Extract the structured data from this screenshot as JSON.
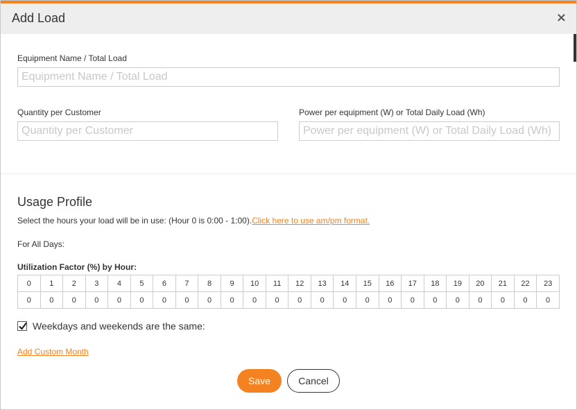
{
  "modal": {
    "title": "Add Load",
    "close_label": "×"
  },
  "fields": {
    "equipment_name": {
      "label": "Equipment Name / Total Load",
      "placeholder": "Equipment Name / Total Load",
      "value": ""
    },
    "quantity": {
      "label": "Quantity per Customer",
      "placeholder": "Quantity per Customer",
      "value": ""
    },
    "power": {
      "label": "Power per equipment (W) or Total Daily Load (Wh)",
      "placeholder": "Power per equipment (W) or Total Daily Load (Wh)",
      "value": ""
    }
  },
  "usage": {
    "title": "Usage Profile",
    "instruction": "Select the hours your load will be in use: (Hour 0 is 0:00 - 1:00).",
    "ampm_link": "Click here to use am/pm format.",
    "for_all_days": "For All Days:",
    "utilization_title": "Utilization Factor (%) by Hour:",
    "hours": [
      "0",
      "1",
      "2",
      "3",
      "4",
      "5",
      "6",
      "7",
      "8",
      "9",
      "10",
      "11",
      "12",
      "13",
      "14",
      "15",
      "16",
      "17",
      "18",
      "19",
      "20",
      "21",
      "22",
      "23"
    ],
    "values": [
      "0",
      "0",
      "0",
      "0",
      "0",
      "0",
      "0",
      "0",
      "0",
      "0",
      "0",
      "0",
      "0",
      "0",
      "0",
      "0",
      "0",
      "0",
      "0",
      "0",
      "0",
      "0",
      "0",
      "0"
    ],
    "same_checkbox_label": "Weekdays and weekends are the same:",
    "same_checked": true,
    "add_custom_month": "Add Custom Month"
  },
  "actions": {
    "save": "Save",
    "cancel": "Cancel"
  },
  "colors": {
    "accent": "#f58220",
    "header_bg": "#eeeeee",
    "border": "#cccccc"
  }
}
